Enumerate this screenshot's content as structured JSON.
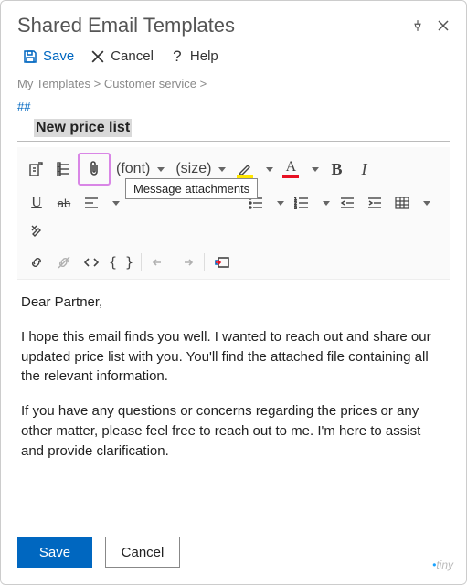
{
  "window": {
    "title": "Shared Email Templates"
  },
  "menu": {
    "save": "Save",
    "cancel": "Cancel",
    "help": "Help"
  },
  "breadcrumb": {
    "root": "My Templates",
    "folder": "Customer service",
    "sep": ">"
  },
  "template": {
    "hash": "##",
    "subject": "New price list"
  },
  "toolbar": {
    "font_label": "(font)",
    "size_label": "(size)",
    "tooltip_attach": "Message attachments"
  },
  "body": {
    "greeting": "Dear Partner,",
    "p1": "I hope this email finds you well. I wanted to reach out and share our updated price list with you. You'll find the attached file containing all the relevant information.",
    "p2": "If you have any questions or concerns regarding the prices or any other matter, please feel free to reach out to me. I'm here to assist and provide clarification."
  },
  "footer": {
    "save": "Save",
    "cancel": "Cancel"
  },
  "brand": {
    "tiny": "tiny"
  }
}
